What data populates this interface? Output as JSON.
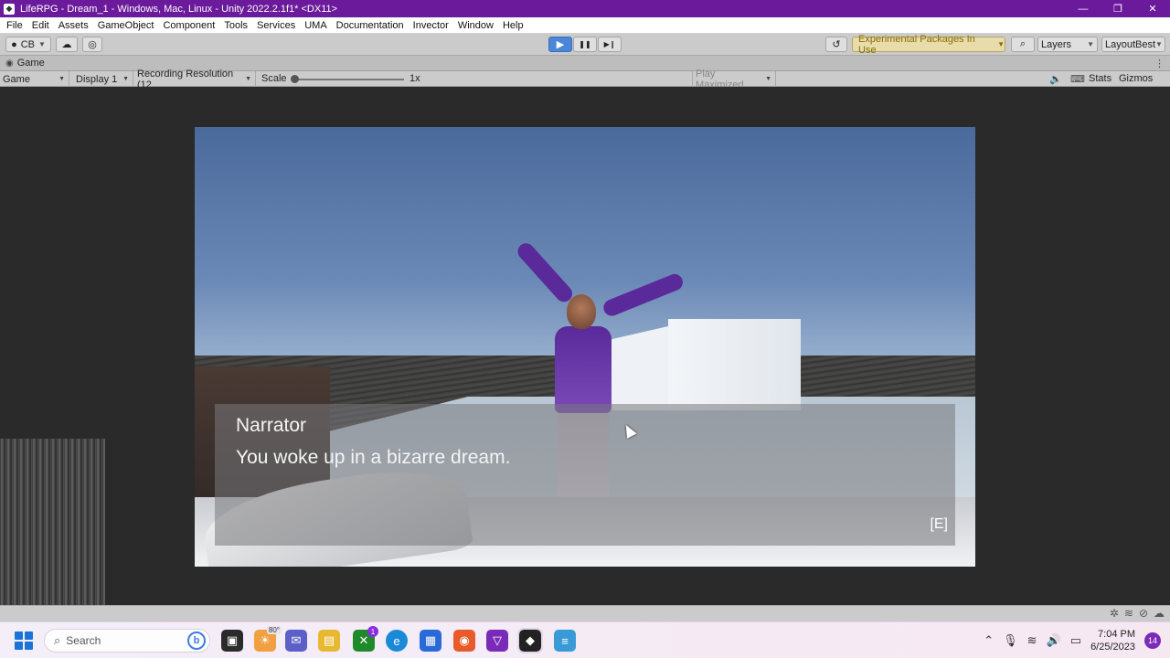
{
  "window": {
    "title": "LifeRPG - Dream_1 - Windows, Mac, Linux - Unity 2022.2.1f1* <DX11>",
    "controls": [
      "—",
      "❐",
      "✕"
    ]
  },
  "menu": [
    "File",
    "Edit",
    "Assets",
    "GameObject",
    "Component",
    "Tools",
    "Services",
    "UMA",
    "Documentation",
    "Invector",
    "Window",
    "Help"
  ],
  "toolbar": {
    "account_label": "CB",
    "play_icon": "▶",
    "pause_icon": "❚❚",
    "step_icon": "▶❙",
    "experimental_label": "Experimental Packages In Use",
    "layers_label": "Layers",
    "layout_label": "LayoutBest"
  },
  "tab": {
    "label": "Game",
    "menu_icon": "⋮"
  },
  "game_toolbar": {
    "view_label": "Game",
    "display_label": "Display 1",
    "resolution_label": "Recording Resolution (12",
    "scale_label": "Scale",
    "scale_value": "1x",
    "play_maximized_label": "Play Maximized",
    "stats_label": "Stats",
    "gizmos_label": "Gizmos"
  },
  "dialog": {
    "speaker": "Narrator",
    "line": "You woke up in a bizarre dream.",
    "key_hint": "[E]"
  },
  "taskbar": {
    "search_placeholder": "Search",
    "weather_temp": "80°",
    "xbox_badge": "1",
    "time": "7:04 PM",
    "date": "6/25/2023",
    "notification_count": "14"
  },
  "colors": {
    "titlebar": "#6a1a9a",
    "play_active": "#4c86d8",
    "experimental_bg": "#e7dcaa"
  }
}
